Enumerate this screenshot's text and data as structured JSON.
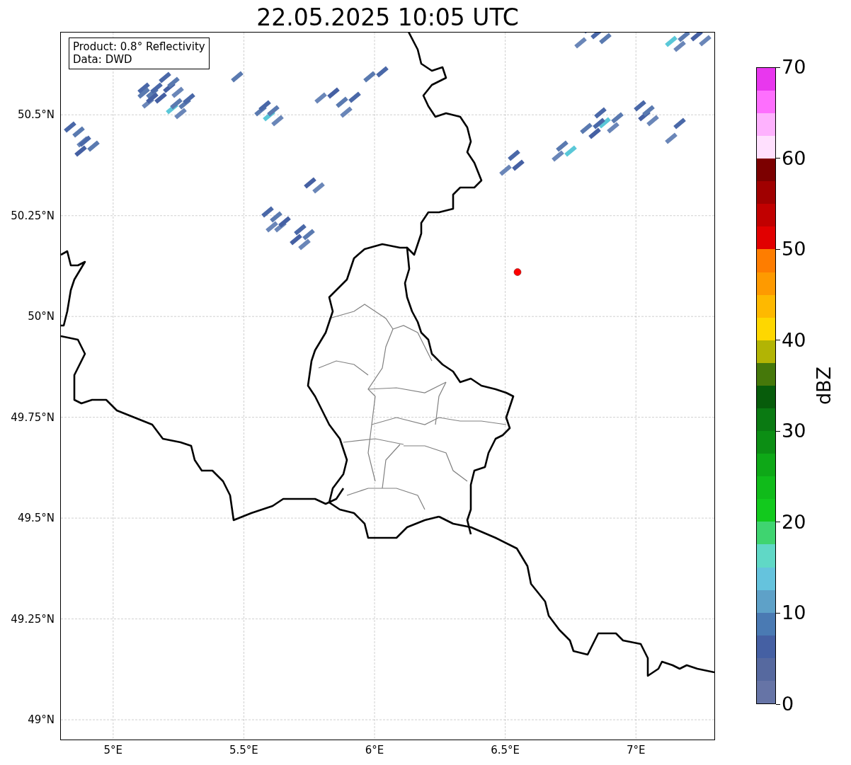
{
  "title": "22.05.2025 10:05 UTC",
  "map": {
    "info": [
      "Product: 0.8° Reflectivity",
      "Data: DWD"
    ],
    "lat_ticks": [
      "50.5°N",
      "50.25°N",
      "50°N",
      "49.75°N",
      "49.5°N",
      "49.25°N",
      "49°N"
    ],
    "lon_ticks": [
      "5°E",
      "5.5°E",
      "6°E",
      "6.5°E",
      "7°E"
    ],
    "station": {
      "color": "#ff0000"
    }
  },
  "colorbar": {
    "label": "dBZ",
    "ticks": [
      "70",
      "60",
      "50",
      "40",
      "30",
      "20",
      "10",
      "0"
    ],
    "bins": [
      {
        "color": "#6674a6"
      },
      {
        "color": "#56699f"
      },
      {
        "color": "#4560a3"
      },
      {
        "color": "#4a7ab3"
      },
      {
        "color": "#5ea1c8"
      },
      {
        "color": "#65c3dd"
      },
      {
        "color": "#60d8c6"
      },
      {
        "color": "#3fd470"
      },
      {
        "color": "#12c91d"
      },
      {
        "color": "#10bb1a"
      },
      {
        "color": "#0ea817"
      },
      {
        "color": "#0c8e14"
      },
      {
        "color": "#0a7a12"
      },
      {
        "color": "#075c0b"
      },
      {
        "color": "#45780a"
      },
      {
        "color": "#b2b404"
      },
      {
        "color": "#fed700"
      },
      {
        "color": "#feb900"
      },
      {
        "color": "#fe9a00"
      },
      {
        "color": "#fe7d00"
      },
      {
        "color": "#e10000"
      },
      {
        "color": "#c10000"
      },
      {
        "color": "#a00000"
      },
      {
        "color": "#7c0000"
      },
      {
        "color": "#ffe0fe"
      },
      {
        "color": "#feb2fe"
      },
      {
        "color": "#fe6ffe"
      },
      {
        "color": "#e837ee"
      }
    ]
  }
}
